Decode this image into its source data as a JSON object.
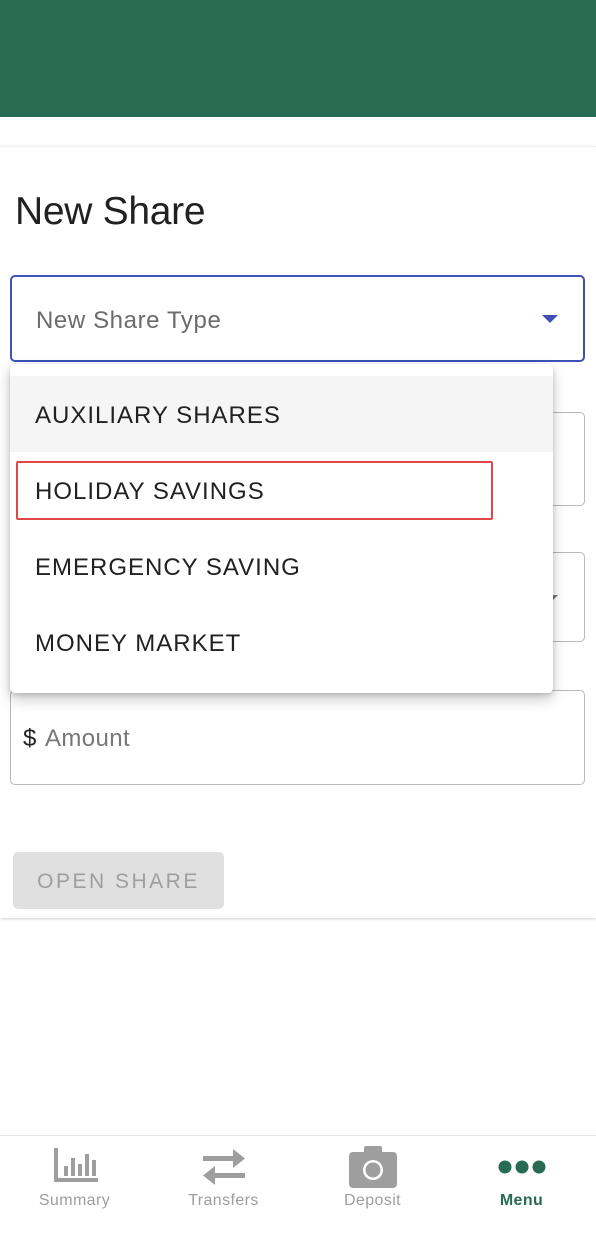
{
  "page": {
    "title": "New Share"
  },
  "form": {
    "share_type_placeholder": "New Share Type",
    "amount_prefix": "$",
    "amount_placeholder": "Amount",
    "open_button_label": "OPEN SHARE"
  },
  "dropdown": {
    "options": [
      {
        "label": "AUXILIARY SHARES"
      },
      {
        "label": "HOLIDAY SAVINGS"
      },
      {
        "label": "EMERGENCY SAVING"
      },
      {
        "label": "MONEY MARKET"
      }
    ]
  },
  "bottom_nav": {
    "items": [
      {
        "label": "Summary",
        "icon": "bar-chart-icon"
      },
      {
        "label": "Transfers",
        "icon": "transfer-arrows-icon"
      },
      {
        "label": "Deposit",
        "icon": "camera-icon"
      },
      {
        "label": "Menu",
        "icon": "more-dots-icon",
        "active": true
      }
    ]
  },
  "colors": {
    "brand": "#276b53",
    "focus": "#3f51b5",
    "highlight": "#e04747"
  }
}
